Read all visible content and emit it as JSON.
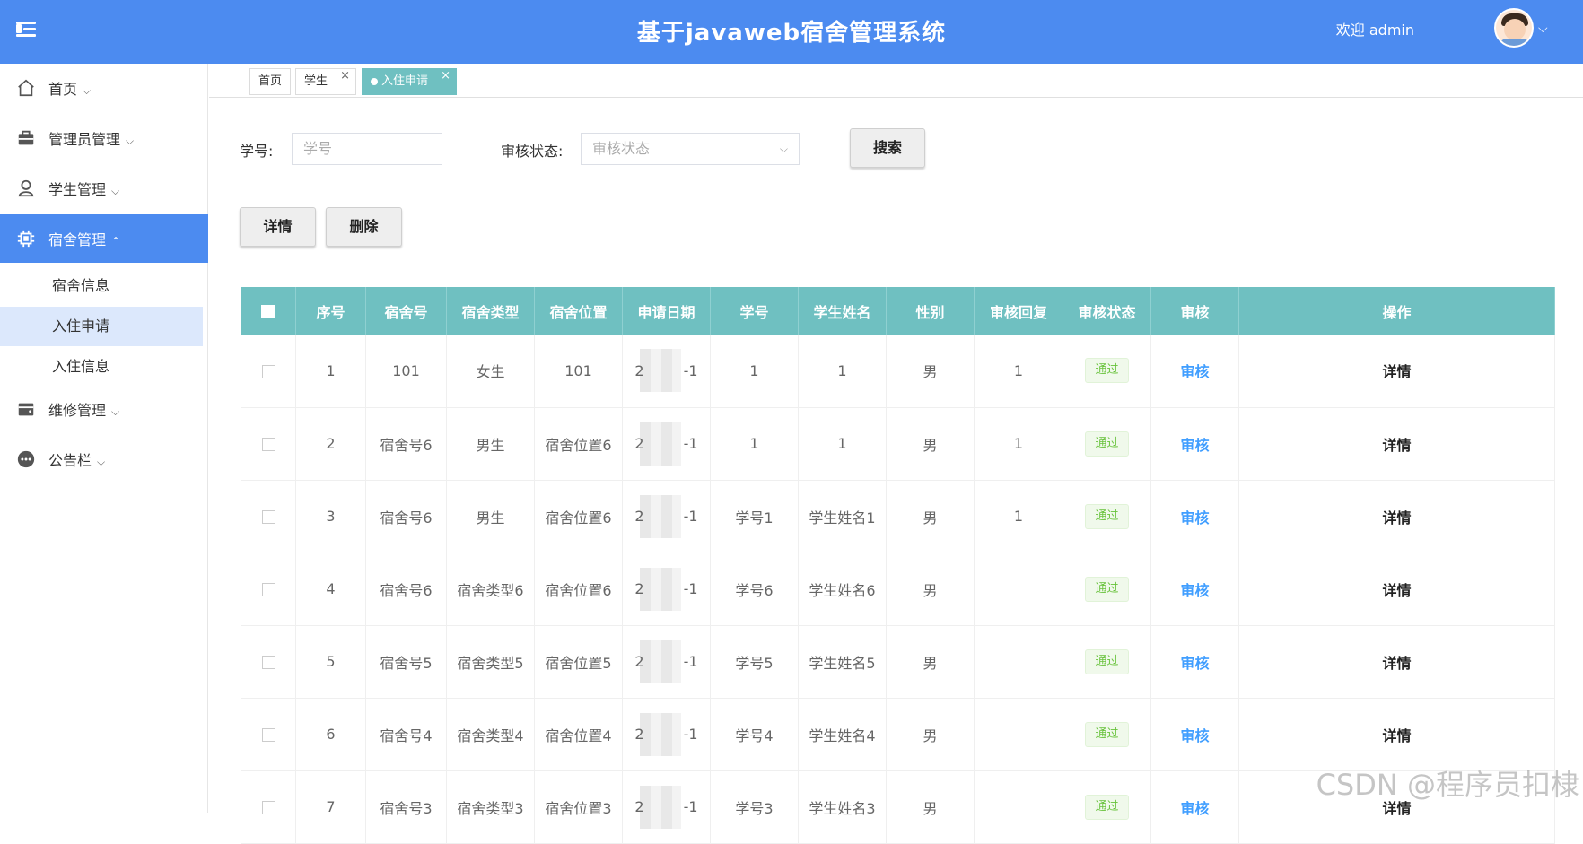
{
  "header": {
    "title": "基于javaweb宿舍管理系统",
    "welcome": "欢迎 admin",
    "caret": "⌵"
  },
  "sidebar": {
    "items": [
      {
        "label": "首页",
        "chev": "⌵",
        "icon": "home-icon"
      },
      {
        "label": "管理员管理",
        "chev": "⌵",
        "icon": "briefcase-icon"
      },
      {
        "label": "学生管理",
        "chev": "⌵",
        "icon": "user-icon"
      },
      {
        "label": "宿舍管理",
        "chev": "⌃",
        "icon": "chip-icon"
      },
      {
        "label": "维修管理",
        "chev": "⌵",
        "icon": "wallet-icon"
      },
      {
        "label": "公告栏",
        "chev": "⌵",
        "icon": "more-circle-icon"
      }
    ],
    "sub_items": [
      {
        "label": "宿舍信息"
      },
      {
        "label": "入住申请"
      },
      {
        "label": "入住信息"
      }
    ]
  },
  "tabs": [
    {
      "label": "首页"
    },
    {
      "label": "学生",
      "close": "×"
    },
    {
      "label": "入住申请",
      "close": "×"
    }
  ],
  "search": {
    "student_no_label": "学号:",
    "student_no_placeholder": "学号",
    "status_label": "审核状态:",
    "status_placeholder": "审核状态",
    "search_button": "搜索"
  },
  "actions": {
    "detail": "详情",
    "delete": "删除"
  },
  "table": {
    "columns": [
      "序号",
      "宿舍号",
      "宿舍类型",
      "宿舍位置",
      "申请日期",
      "学号",
      "学生姓名",
      "性别",
      "审核回复",
      "审核状态",
      "审核",
      "操作"
    ],
    "rows": [
      {
        "no": "1",
        "room": "101",
        "type": "女生",
        "loc": "101",
        "date_a": "2",
        "date_b": "-1",
        "sid": "1",
        "name": "1",
        "gender": "男",
        "reply": "1",
        "status": "通过",
        "audit": "审核",
        "op": "详情"
      },
      {
        "no": "2",
        "room": "宿舍号6",
        "type": "男生",
        "loc": "宿舍位置6",
        "date_a": "2",
        "date_b": "-1",
        "sid": "1",
        "name": "1",
        "gender": "男",
        "reply": "1",
        "status": "通过",
        "audit": "审核",
        "op": "详情"
      },
      {
        "no": "3",
        "room": "宿舍号6",
        "type": "男生",
        "loc": "宿舍位置6",
        "date_a": "2",
        "date_b": "-1",
        "sid": "学号1",
        "name": "学生姓名1",
        "gender": "男",
        "reply": "1",
        "status": "通过",
        "audit": "审核",
        "op": "详情"
      },
      {
        "no": "4",
        "room": "宿舍号6",
        "type": "宿舍类型6",
        "loc": "宿舍位置6",
        "date_a": "2",
        "date_b": "-1",
        "sid": "学号6",
        "name": "学生姓名6",
        "gender": "男",
        "reply": "",
        "status": "通过",
        "audit": "审核",
        "op": "详情"
      },
      {
        "no": "5",
        "room": "宿舍号5",
        "type": "宿舍类型5",
        "loc": "宿舍位置5",
        "date_a": "2",
        "date_b": "-1",
        "sid": "学号5",
        "name": "学生姓名5",
        "gender": "男",
        "reply": "",
        "status": "通过",
        "audit": "审核",
        "op": "详情"
      },
      {
        "no": "6",
        "room": "宿舍号4",
        "type": "宿舍类型4",
        "loc": "宿舍位置4",
        "date_a": "2",
        "date_b": "-1",
        "sid": "学号4",
        "name": "学生姓名4",
        "gender": "男",
        "reply": "",
        "status": "通过",
        "audit": "审核",
        "op": "详情"
      },
      {
        "no": "7",
        "room": "宿舍号3",
        "type": "宿舍类型3",
        "loc": "宿舍位置3",
        "date_a": "2",
        "date_b": "-1",
        "sid": "学号3",
        "name": "学生姓名3",
        "gender": "男",
        "reply": "",
        "status": "通过",
        "audit": "审核",
        "op": "详情"
      }
    ]
  },
  "watermark": "CSDN @程序员扣棣",
  "colors": {
    "header": "#4c8bf0",
    "table_header": "#6fc0c1",
    "active_tab": "#6fc0c1"
  }
}
